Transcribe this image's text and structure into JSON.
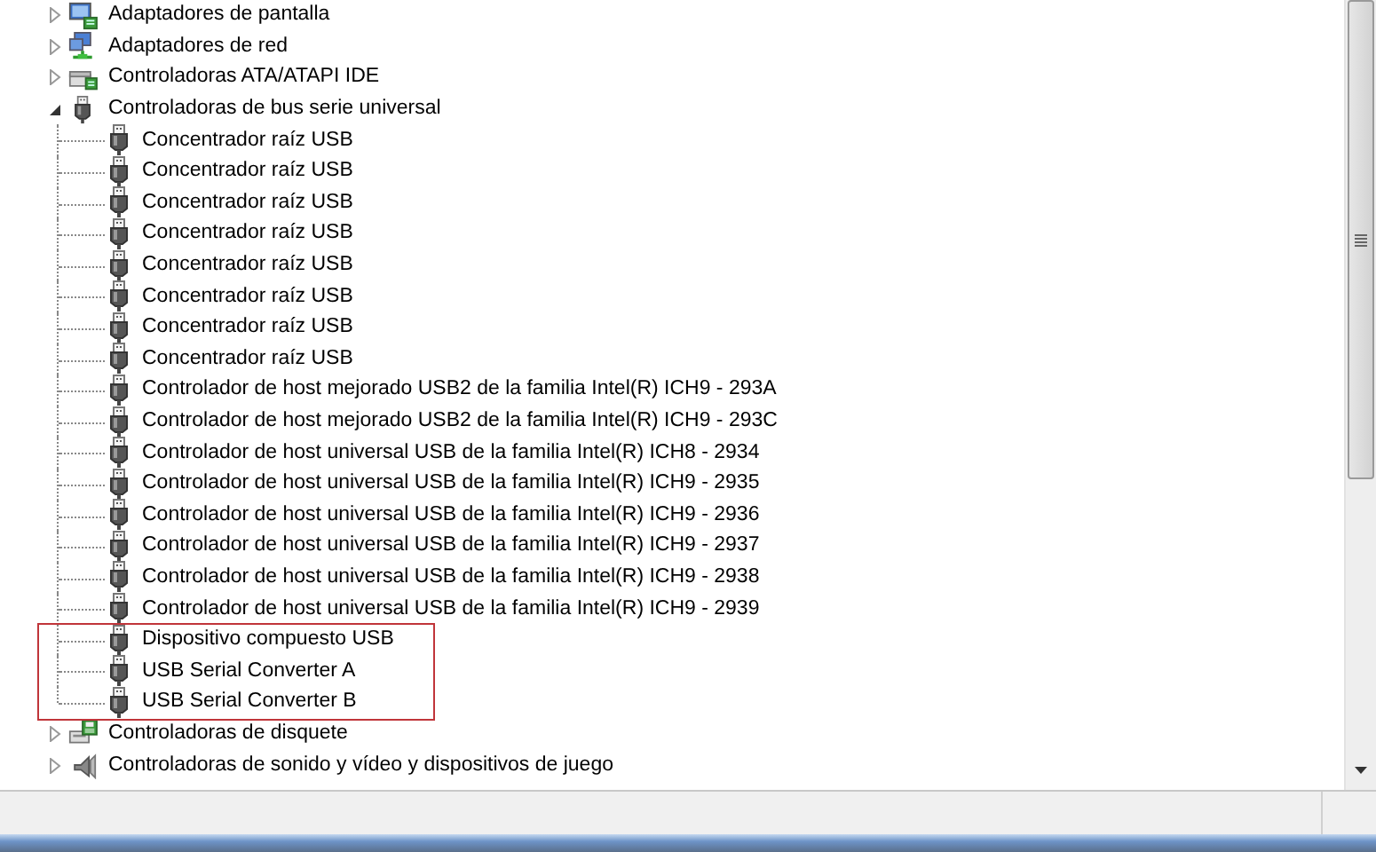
{
  "tree": [
    {
      "label": "Adaptadores de pantalla",
      "kind": "display",
      "expanded": false
    },
    {
      "label": "Adaptadores de red",
      "kind": "network",
      "expanded": false
    },
    {
      "label": "Controladoras ATA/ATAPI IDE",
      "kind": "ide",
      "expanded": false
    },
    {
      "label": "Controladoras de bus serie universal",
      "kind": "usb",
      "expanded": true,
      "children": [
        {
          "label": "Concentrador raíz USB",
          "highlighted": false
        },
        {
          "label": "Concentrador raíz USB",
          "highlighted": false
        },
        {
          "label": "Concentrador raíz USB",
          "highlighted": false
        },
        {
          "label": "Concentrador raíz USB",
          "highlighted": false
        },
        {
          "label": "Concentrador raíz USB",
          "highlighted": false
        },
        {
          "label": "Concentrador raíz USB",
          "highlighted": false
        },
        {
          "label": "Concentrador raíz USB",
          "highlighted": false
        },
        {
          "label": "Concentrador raíz USB",
          "highlighted": false
        },
        {
          "label": "Controlador de host mejorado USB2 de la familia Intel(R) ICH9 - 293A",
          "highlighted": false
        },
        {
          "label": "Controlador de host mejorado USB2 de la familia Intel(R) ICH9 - 293C",
          "highlighted": false
        },
        {
          "label": "Controlador de host universal USB de la familia Intel(R) ICH8 - 2934",
          "highlighted": false
        },
        {
          "label": "Controlador de host universal USB de la familia Intel(R) ICH9 - 2935",
          "highlighted": false
        },
        {
          "label": "Controlador de host universal USB de la familia Intel(R) ICH9 - 2936",
          "highlighted": false
        },
        {
          "label": "Controlador de host universal USB de la familia Intel(R) ICH9 - 2937",
          "highlighted": false
        },
        {
          "label": "Controlador de host universal USB de la familia Intel(R) ICH9 - 2938",
          "highlighted": false
        },
        {
          "label": "Controlador de host universal USB de la familia Intel(R) ICH9 - 2939",
          "highlighted": false
        },
        {
          "label": "Dispositivo compuesto USB",
          "highlighted": true
        },
        {
          "label": "USB Serial Converter A",
          "highlighted": true
        },
        {
          "label": "USB Serial Converter B",
          "highlighted": true
        }
      ]
    },
    {
      "label": "Controladoras de disquete",
      "kind": "floppy",
      "expanded": false
    },
    {
      "label": "Controladoras de sonido y vídeo y dispositivos de juego",
      "kind": "sound",
      "expanded": false
    }
  ]
}
